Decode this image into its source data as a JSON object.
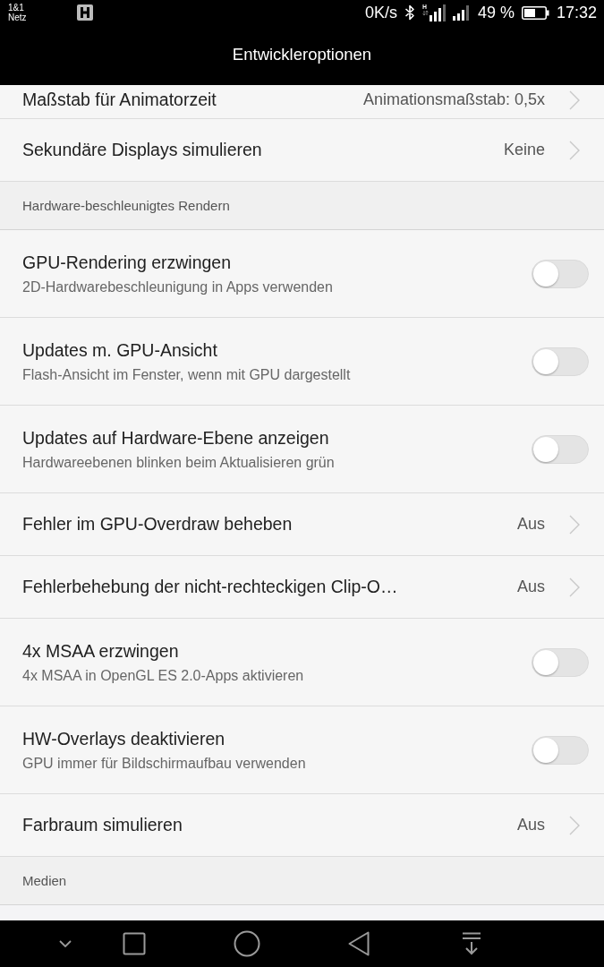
{
  "status_bar": {
    "carrier": [
      "1&1",
      "Netz"
    ],
    "network_speed": "0K/s",
    "battery_percent": "49 %",
    "time": "17:32"
  },
  "app_bar": {
    "title": "Entwickleroptionen"
  },
  "items": [
    {
      "kind": "value",
      "title": "Maßstab für Animatorzeit",
      "value": "Animationsmaßstab: 0,5x"
    },
    {
      "kind": "value",
      "title": "Sekundäre Displays simulieren",
      "value": "Keine"
    },
    {
      "kind": "section",
      "title": "Hardware-beschleunigtes Rendern"
    },
    {
      "kind": "switch",
      "title": "GPU-Rendering erzwingen",
      "subtitle": "2D-Hardwarebeschleunigung in Apps verwenden",
      "on": false
    },
    {
      "kind": "switch",
      "title": "Updates m. GPU-Ansicht",
      "subtitle": "Flash-Ansicht im Fenster, wenn mit GPU dargestellt",
      "on": false
    },
    {
      "kind": "switch",
      "title": "Updates auf Hardware-Ebene anzeigen",
      "subtitle": "Hardwareebenen blinken beim Aktualisieren grün",
      "on": false
    },
    {
      "kind": "value",
      "title": "Fehler im GPU-Overdraw beheben",
      "value": "Aus"
    },
    {
      "kind": "value",
      "title": "Fehlerbehebung der nicht-rechteckigen Clip-O…",
      "value": "Aus"
    },
    {
      "kind": "switch",
      "title": "4x MSAA erzwingen",
      "subtitle": "4x MSAA in OpenGL ES 2.0-Apps aktivieren",
      "on": false
    },
    {
      "kind": "switch",
      "title": "HW-Overlays deaktivieren",
      "subtitle": "GPU immer für Bildschirmaufbau verwenden",
      "on": false
    },
    {
      "kind": "value",
      "title": "Farbraum simulieren",
      "value": "Aus"
    },
    {
      "kind": "section",
      "title": "Medien"
    }
  ]
}
